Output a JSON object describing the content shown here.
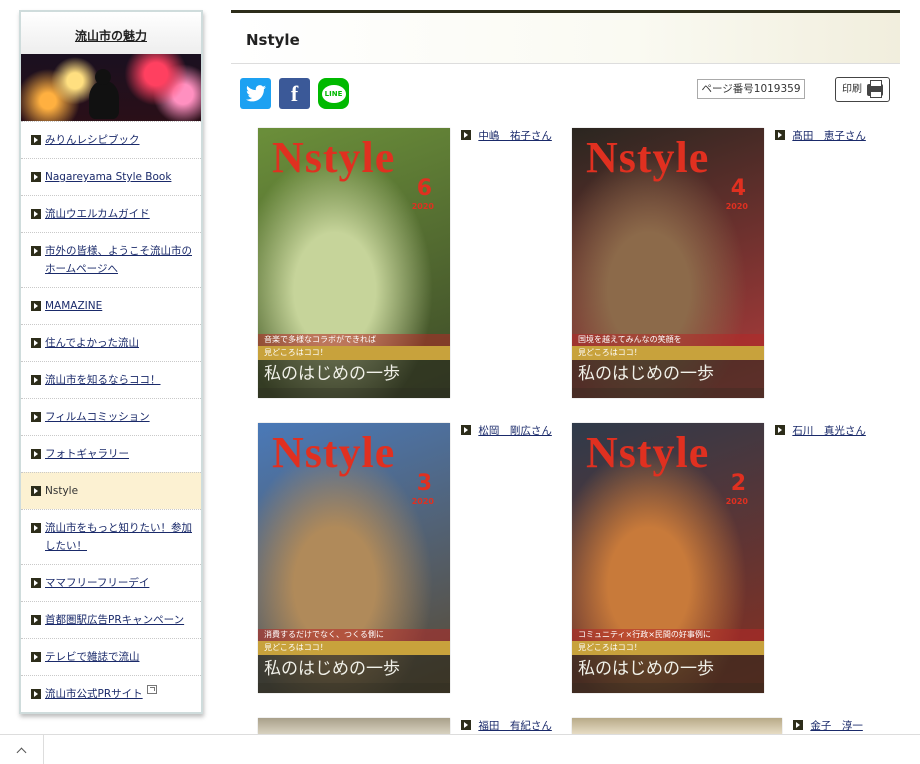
{
  "sidebar": {
    "title": "流山市の魅力",
    "items": [
      {
        "label": "みりんレシピブック"
      },
      {
        "label": "Nagareyama Style Book"
      },
      {
        "label": "流山ウエルカムガイド"
      },
      {
        "label": "市外の皆様、ようこそ流山市のホームページへ"
      },
      {
        "label": "MAMAZINE"
      },
      {
        "label": "住んでよかった流山"
      },
      {
        "label": "流山市を知るならココ！"
      },
      {
        "label": "フィルムコミッション"
      },
      {
        "label": "フォトギャラリー"
      },
      {
        "label": "Nstyle"
      },
      {
        "label": "流山市をもっと知りたい！参加したい！"
      },
      {
        "label": "ママフリーフリーデイ"
      },
      {
        "label": "首都圏駅広告PRキャンペーン"
      },
      {
        "label": "テレビで雑誌で流山"
      },
      {
        "label": "流山市公式PRサイト"
      }
    ]
  },
  "main": {
    "title": "Nstyle",
    "share": {
      "twitter": "twitter-icon",
      "facebook": "facebook-icon",
      "line": "LINE"
    },
    "page_number": "ページ番号1019359",
    "print_label": "印刷"
  },
  "cards": [
    {
      "name": "中嶋　祐子さん",
      "issue": "6",
      "year": "2020",
      "bar": "見どころはココ！",
      "headline": "私のはじめの一歩",
      "slogan": "音楽で多様なコラボができれば",
      "palette": [
        "#6b8f3a",
        "#c6d49a",
        "#3d4a28"
      ]
    },
    {
      "name": "髙田　恵子さん",
      "issue": "4",
      "year": "2020",
      "bar": "見どころはココ！",
      "headline": "私のはじめの一歩",
      "slogan": "国境を越えてみんなの笑顔を",
      "palette": [
        "#2a2620",
        "#8c6a4a",
        "#b23c3c"
      ]
    },
    {
      "name": "松岡　剛広さん",
      "issue": "3",
      "year": "2020",
      "bar": "見どころはココ！",
      "headline": "私のはじめの一歩",
      "slogan": "消費するだけでなく、つくる側に",
      "palette": [
        "#4a79b8",
        "#b08a5a",
        "#5a4a30"
      ]
    },
    {
      "name": "石川　真光さん",
      "issue": "2",
      "year": "2020",
      "bar": "見どころはココ！",
      "headline": "私のはじめの一歩",
      "slogan": "コミュニティ×行政×民間の好事例に",
      "palette": [
        "#2f3a4a",
        "#c87a3a",
        "#8a3020"
      ]
    },
    {
      "name": "福田　有紀さん"
    },
    {
      "name": "金子　淳一"
    }
  ],
  "colors": {
    "accent": "#2d2d1a",
    "link": "#1a2a6a",
    "current_bg": "#fcf1d2",
    "title_red": "#e03020"
  }
}
